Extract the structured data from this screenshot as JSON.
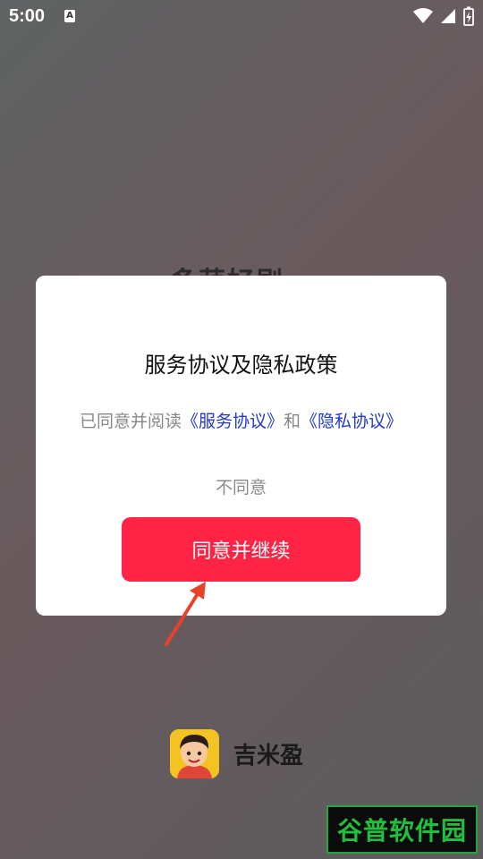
{
  "status_bar": {
    "time": "5:00",
    "notification_letter": "A"
  },
  "background": {
    "title_partial": "多萌好剧"
  },
  "dialog": {
    "title": "服务协议及隐私政策",
    "agree_prefix": "已同意并阅读",
    "service_link": "《服务协议》",
    "connector": "和",
    "privacy_link": "《隐私协议》",
    "disagree_label": "不同意",
    "continue_label": "同意并继续"
  },
  "brand": {
    "name": "吉米盈"
  },
  "watermark": {
    "text": "谷普软件园"
  },
  "colors": {
    "accent": "#ff2444",
    "link": "#2339c9"
  }
}
